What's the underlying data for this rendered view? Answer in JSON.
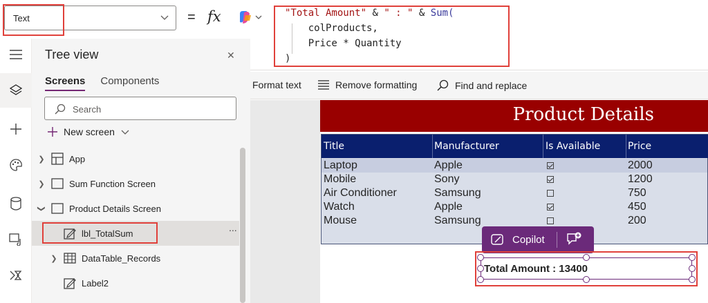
{
  "property_bar": {
    "selected_property": "Text",
    "equals": "=",
    "fx": "fx"
  },
  "formula": {
    "line1_str1": "\"Total Amount\"",
    "line1_op1": " & ",
    "line1_str2": "\" : \"",
    "line1_op2": " & ",
    "line1_fn": "Sum(",
    "line2": "    colProducts,",
    "line3": "    Price * Quantity",
    "line4": ")"
  },
  "formula_tools": {
    "format_text": "Format text",
    "remove_formatting": "Remove formatting",
    "find_replace": "Find and replace"
  },
  "tree": {
    "title": "Tree view",
    "tabs": [
      "Screens",
      "Components"
    ],
    "search_placeholder": "Search",
    "new_screen": "New screen",
    "items": [
      {
        "label": "App"
      },
      {
        "label": "Sum Function Screen"
      },
      {
        "label": "Product Details Screen"
      },
      {
        "label": "lbl_TotalSum"
      },
      {
        "label": "DataTable_Records"
      },
      {
        "label": "Label2"
      }
    ],
    "more": "..."
  },
  "canvas": {
    "header_title": "Product Details",
    "table": {
      "columns": [
        "Title",
        "Manufacturer",
        "Is Available",
        "Price"
      ],
      "rows": [
        {
          "title": "Laptop",
          "manufacturer": "Apple",
          "available": true,
          "price": "2000"
        },
        {
          "title": "Mobile",
          "manufacturer": "Sony",
          "available": true,
          "price": "1200"
        },
        {
          "title": "Air Conditioner",
          "manufacturer": "Samsung",
          "available": false,
          "price": "750"
        },
        {
          "title": "Watch",
          "manufacturer": "Apple",
          "available": true,
          "price": "450"
        },
        {
          "title": "Mouse",
          "manufacturer": "Samsung",
          "available": false,
          "price": "200"
        }
      ]
    },
    "copilot_label": "Copilot",
    "total_label": "Total Amount : 13400"
  },
  "colors": {
    "accent": "#742774",
    "header_red": "#990000",
    "table_head": "#0a1f6e",
    "annotation": "#e0403a"
  }
}
